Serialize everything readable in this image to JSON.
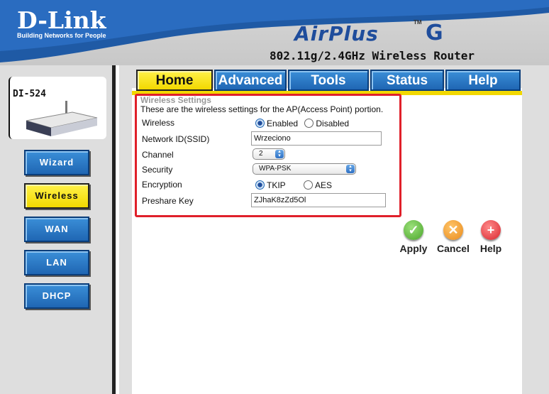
{
  "header": {
    "brand": "D-Link",
    "tagline": "Building Networks for People",
    "product_logo": "AirPlus",
    "product_tm": "TM",
    "product_g": "G",
    "subtitle": "802.11g/2.4GHz Wireless Router"
  },
  "device": {
    "model": "DI-524"
  },
  "sidebar": {
    "items": [
      {
        "label": "Wizard",
        "active": false
      },
      {
        "label": "Wireless",
        "active": true
      },
      {
        "label": "WAN",
        "active": false
      },
      {
        "label": "LAN",
        "active": false
      },
      {
        "label": "DHCP",
        "active": false
      }
    ]
  },
  "tabs": [
    {
      "label": "Home",
      "active": true
    },
    {
      "label": "Advanced",
      "active": false
    },
    {
      "label": "Tools",
      "active": false
    },
    {
      "label": "Status",
      "active": false
    },
    {
      "label": "Help",
      "active": false
    }
  ],
  "wireless": {
    "title": "Wireless Settings",
    "description": "These are the wireless settings for the AP(Access Point) portion.",
    "wireless_label": "Wireless",
    "enabled_label": "Enabled",
    "disabled_label": "Disabled",
    "wireless_state": "Enabled",
    "ssid_label": "Network ID(SSID)",
    "ssid_value": "Wrzeciono",
    "channel_label": "Channel",
    "channel_value": "2",
    "security_label": "Security",
    "security_value": "WPA-PSK",
    "encryption_label": "Encryption",
    "tkip_label": "TKIP",
    "aes_label": "AES",
    "encryption_state": "TKIP",
    "preshare_label": "Preshare Key",
    "preshare_value": "ZJhaK8zZd5Ol"
  },
  "actions": {
    "apply": "Apply",
    "cancel": "Cancel",
    "help": "Help"
  },
  "colors": {
    "nav_blue": "#1f66b3",
    "active_yellow": "#f2d800",
    "frame_red": "#e0202a",
    "apply_green": "#4aa52a",
    "cancel_orange": "#e98a1a",
    "help_red": "#d9262e"
  }
}
